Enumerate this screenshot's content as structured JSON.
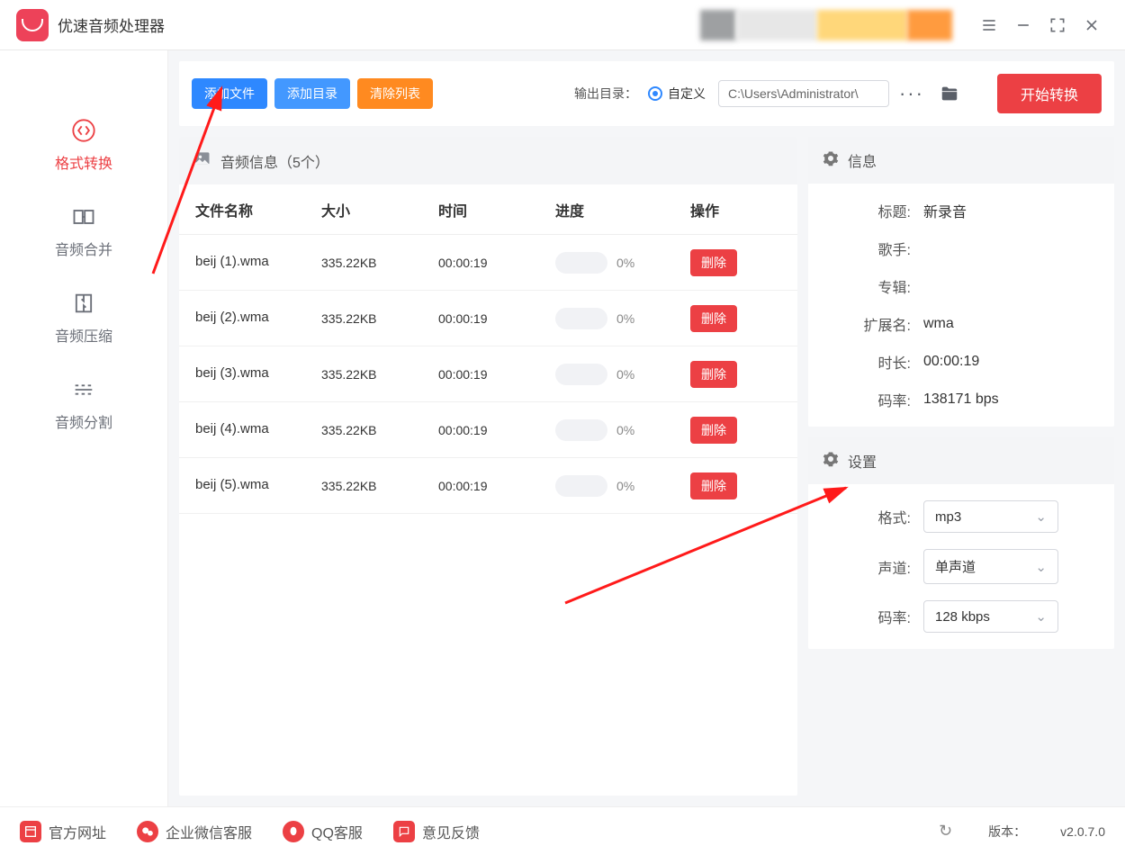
{
  "app": {
    "title": "优速音频处理器"
  },
  "window": {
    "menu_icon": "menu",
    "minimize": "−",
    "fullscreen": "fullscreen",
    "close": "×"
  },
  "sidebar": {
    "items": [
      {
        "label": "格式转换",
        "id": "format"
      },
      {
        "label": "音频合并",
        "id": "merge"
      },
      {
        "label": "音频压缩",
        "id": "compress"
      },
      {
        "label": "音频分割",
        "id": "split"
      }
    ]
  },
  "toolbar": {
    "add_file": "添加文件",
    "add_dir": "添加目录",
    "clear_list": "清除列表",
    "out_dir_label": "输出目录：",
    "out_dir_radio": "自定义",
    "out_dir_path": "C:\\Users\\Administrator\\",
    "start": "开始转换"
  },
  "audio_section": {
    "title": "音频信息（5个）",
    "cols": {
      "name": "文件名称",
      "size": "大小",
      "time": "时间",
      "progress": "进度",
      "op": "操作"
    },
    "delete_label": "删除",
    "rows": [
      {
        "name": "beij (1).wma",
        "size": "335.22KB",
        "time": "00:00:19",
        "pct": "0%"
      },
      {
        "name": "beij (2).wma",
        "size": "335.22KB",
        "time": "00:00:19",
        "pct": "0%"
      },
      {
        "name": "beij (3).wma",
        "size": "335.22KB",
        "time": "00:00:19",
        "pct": "0%"
      },
      {
        "name": "beij (4).wma",
        "size": "335.22KB",
        "time": "00:00:19",
        "pct": "0%"
      },
      {
        "name": "beij (5).wma",
        "size": "335.22KB",
        "time": "00:00:19",
        "pct": "0%"
      }
    ]
  },
  "info_panel": {
    "heading": "信息",
    "fields": {
      "title_k": "标题:",
      "title_v": "新录音",
      "artist_k": "歌手:",
      "artist_v": "",
      "album_k": "专辑:",
      "album_v": "",
      "ext_k": "扩展名:",
      "ext_v": "wma",
      "dur_k": "时长:",
      "dur_v": "00:00:19",
      "bitrate_k": "码率:",
      "bitrate_v": "138171 bps"
    }
  },
  "settings_panel": {
    "heading": "设置",
    "format_k": "格式:",
    "format_v": "mp3",
    "channel_k": "声道:",
    "channel_v": "单声道",
    "bitrate_k": "码率:",
    "bitrate_v": "128 kbps"
  },
  "footer": {
    "site": "官方网址",
    "wechat": "企业微信客服",
    "qq": "QQ客服",
    "feedback": "意见反馈",
    "version_label": "版本：",
    "version": "v2.0.7.0"
  }
}
